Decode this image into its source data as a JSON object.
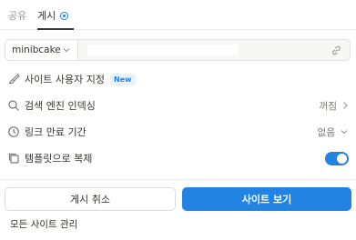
{
  "tabs": {
    "share": "공유",
    "publish": "게시"
  },
  "url_bar": {
    "domain": "minibcake",
    "url_value": ""
  },
  "settings": {
    "customize": {
      "label": "사이트 사용자 지정",
      "badge": "New"
    },
    "search_index": {
      "label": "검색 엔진 인덱싱",
      "value": "꺼짐"
    },
    "link_expiry": {
      "label": "링크 만료 기간",
      "value": "없음"
    },
    "duplicate_template": {
      "label": "템플릿으로 복제",
      "enabled": true
    }
  },
  "buttons": {
    "unpublish": "게시 취소",
    "view_site": "사이트 보기"
  },
  "footer": {
    "manage_sites": "모든 사이트 관리"
  },
  "colors": {
    "accent": "#2383e2",
    "text": "#37352f",
    "muted": "#9b9a97"
  }
}
